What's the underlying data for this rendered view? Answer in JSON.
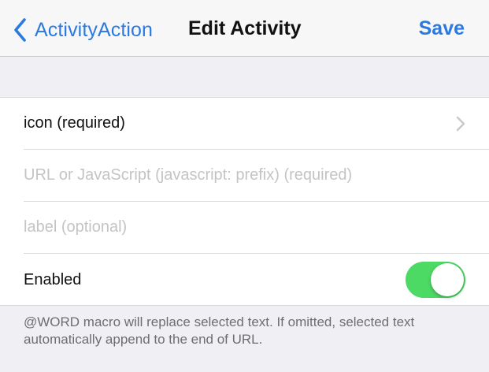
{
  "navbar": {
    "back_label": "ActivityAction",
    "title": "Edit Activity",
    "save_label": "Save"
  },
  "form": {
    "icon_row": {
      "label": "icon (required)"
    },
    "url_field": {
      "value": "",
      "placeholder": "URL or JavaScript (javascript: prefix) (required)"
    },
    "label_field": {
      "value": "",
      "placeholder": "label (optional)"
    },
    "enabled_row": {
      "label": "Enabled",
      "enabled": true
    }
  },
  "footer": {
    "note": "@WORD macro will replace selected text. If omitted, selected text automatically append to the end of URL."
  },
  "colors": {
    "accent": "#2b7ae0",
    "toggle_on": "#4cd964",
    "background": "#efeff4"
  }
}
